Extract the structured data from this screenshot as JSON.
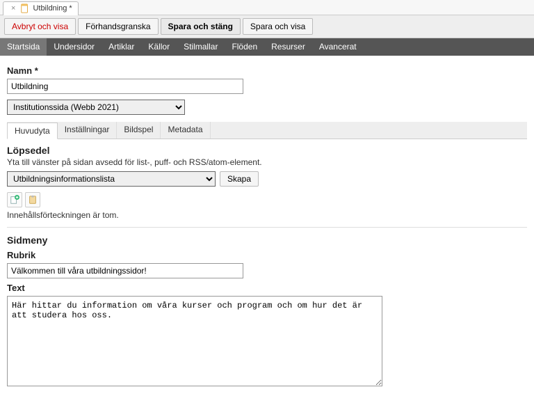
{
  "tab": {
    "title": "Utbildning  *"
  },
  "actionbar": {
    "cancel": "Avbryt och visa",
    "preview": "Förhandsgranska",
    "save_close": "Spara och stäng",
    "save_show": "Spara och visa"
  },
  "nav": {
    "items": [
      "Startsida",
      "Undersidor",
      "Artiklar",
      "Källor",
      "Stilmallar",
      "Flöden",
      "Resurser",
      "Avancerat"
    ],
    "active_index": 0
  },
  "fields": {
    "name_label": "Namn *",
    "name_value": "Utbildning",
    "template_select": "Institutionssida (Webb 2021)"
  },
  "subtabs": {
    "items": [
      "Huvudyta",
      "Inställningar",
      "Bildspel",
      "Metadata"
    ],
    "active_index": 0
  },
  "lopsedel": {
    "heading": "Löpsedel",
    "desc": "Yta till vänster på sidan avsedd för list-, puff- och RSS/atom-element.",
    "select_value": "Utbildningsinformationslista",
    "create_btn": "Skapa",
    "empty": "Innehållsförteckningen är tom."
  },
  "sidmeny": {
    "heading": "Sidmeny",
    "rubrik_label": "Rubrik",
    "rubrik_value": "Välkommen till våra utbildningssidor!",
    "text_label": "Text",
    "text_value": "Här hittar du information om våra kurser och program och om hur det är att studera hos oss."
  }
}
